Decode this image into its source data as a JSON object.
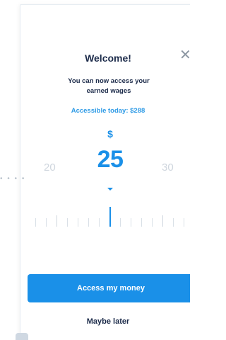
{
  "dialog": {
    "title": "Welcome!",
    "subtitle": "You can now access your earned wages",
    "accessible_text": "Accessible today: $288",
    "close_glyph": "✕"
  },
  "picker": {
    "currency_symbol": "$",
    "selected_amount": "25",
    "prev_amount": "20",
    "next_amount": "30"
  },
  "actions": {
    "primary_label": "Access my money",
    "secondary_label": "Maybe later"
  },
  "decor": {
    "dots": "• • • •"
  },
  "colors": {
    "accent": "#1a90e8",
    "text": "#1c2b4a",
    "muted": "#cfd6de"
  }
}
